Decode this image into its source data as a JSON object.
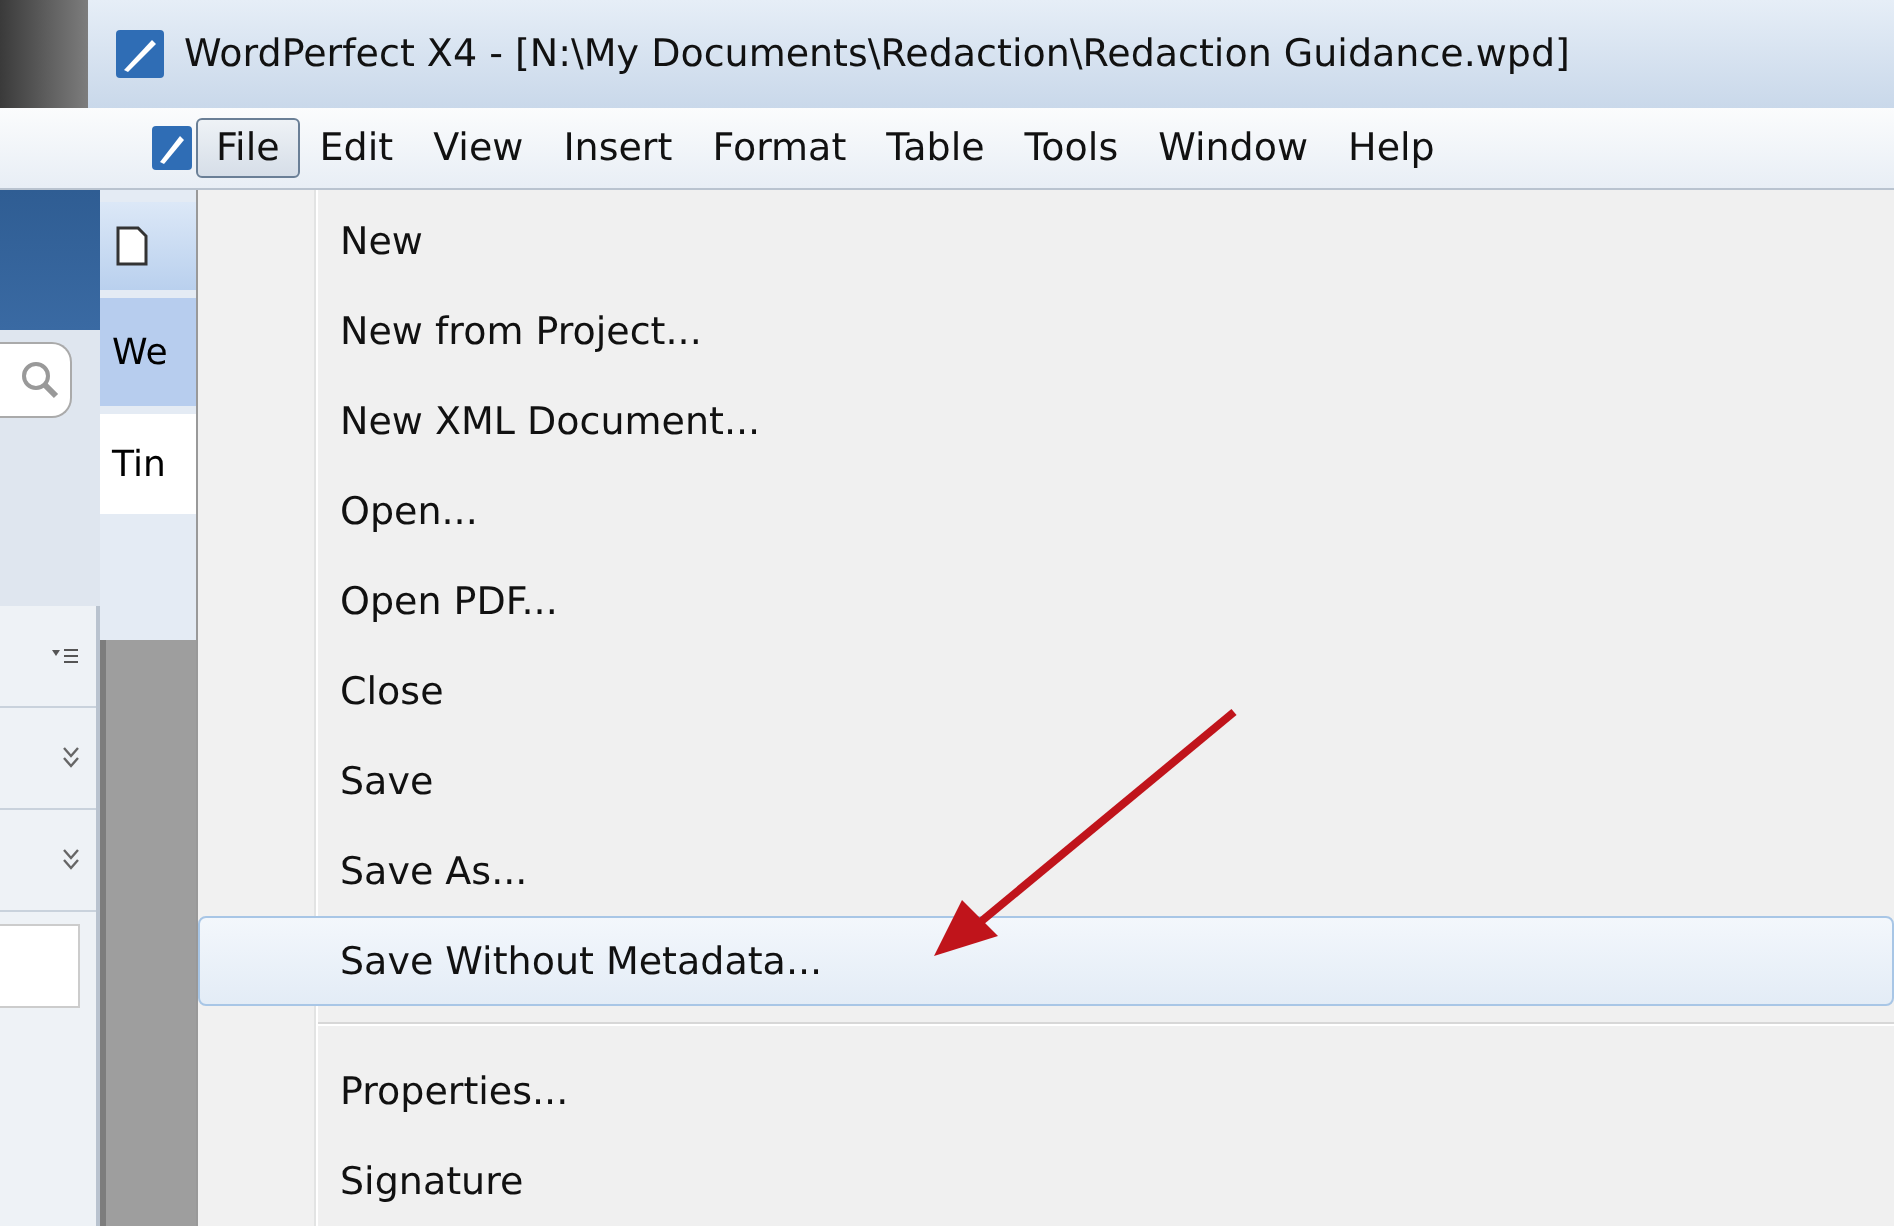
{
  "window": {
    "title": "WordPerfect X4 - [N:\\My Documents\\Redaction\\Redaction Guidance.wpd]"
  },
  "menu_bar": [
    {
      "label": "File",
      "selected": true
    },
    {
      "label": "Edit",
      "selected": false
    },
    {
      "label": "View",
      "selected": false
    },
    {
      "label": "Insert",
      "selected": false
    },
    {
      "label": "Format",
      "selected": false
    },
    {
      "label": "Table",
      "selected": false
    },
    {
      "label": "Tools",
      "selected": false
    },
    {
      "label": "Window",
      "selected": false
    },
    {
      "label": "Help",
      "selected": false
    }
  ],
  "side_strip": {
    "tab": "We",
    "field_value": "Tin"
  },
  "file_menu": [
    {
      "kind": "item",
      "label": "New",
      "selected": false
    },
    {
      "kind": "item",
      "label": "New from Project...",
      "selected": false
    },
    {
      "kind": "item",
      "label": "New XML Document...",
      "selected": false
    },
    {
      "kind": "item",
      "label": "Open...",
      "selected": false
    },
    {
      "kind": "item",
      "label": "Open PDF...",
      "selected": false
    },
    {
      "kind": "item",
      "label": "Close",
      "selected": false
    },
    {
      "kind": "item",
      "label": "Save",
      "selected": false
    },
    {
      "kind": "item",
      "label": "Save As...",
      "selected": false
    },
    {
      "kind": "item",
      "label": "Save Without Metadata...",
      "selected": true
    },
    {
      "kind": "separator"
    },
    {
      "kind": "item",
      "label": "Properties...",
      "selected": false
    },
    {
      "kind": "item",
      "label": "Signature",
      "selected": false
    }
  ]
}
